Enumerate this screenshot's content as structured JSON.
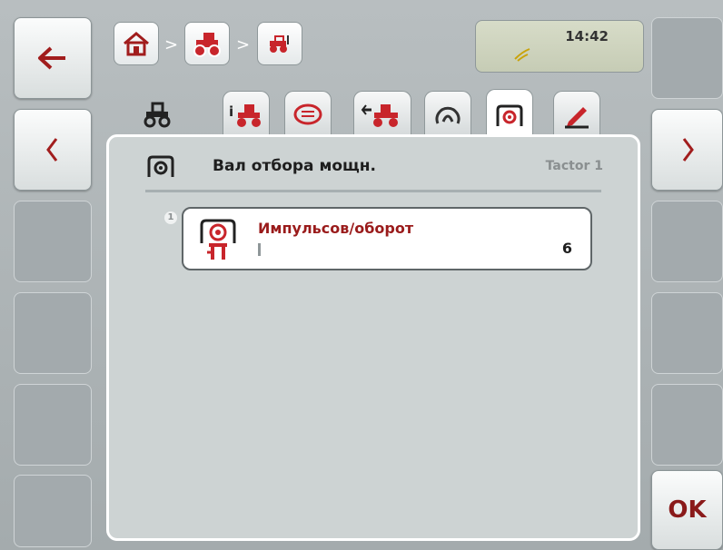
{
  "header": {
    "time": "14:42",
    "breadcrumb": [
      "home-icon",
      "tractor-icon",
      "tractor-small-icon"
    ],
    "separator": ">"
  },
  "tabs": [
    {
      "icon": "tractor-icon"
    },
    {
      "icon": "tractor-info-icon"
    },
    {
      "icon": "message-icon"
    },
    {
      "icon": "tractor-connect-icon"
    },
    {
      "icon": "speed-gauge-icon"
    },
    {
      "icon": "pto-icon"
    },
    {
      "icon": "edit-pen-icon"
    }
  ],
  "panel": {
    "title": "Вал отбора мощн.",
    "subtitle": "Tactor 1"
  },
  "param": {
    "index": "1",
    "name": "Импульсов/оборот",
    "value": "6"
  },
  "ok_label": "OK",
  "colors": {
    "accent": "#b61e24",
    "text": "#1e1e1e"
  }
}
